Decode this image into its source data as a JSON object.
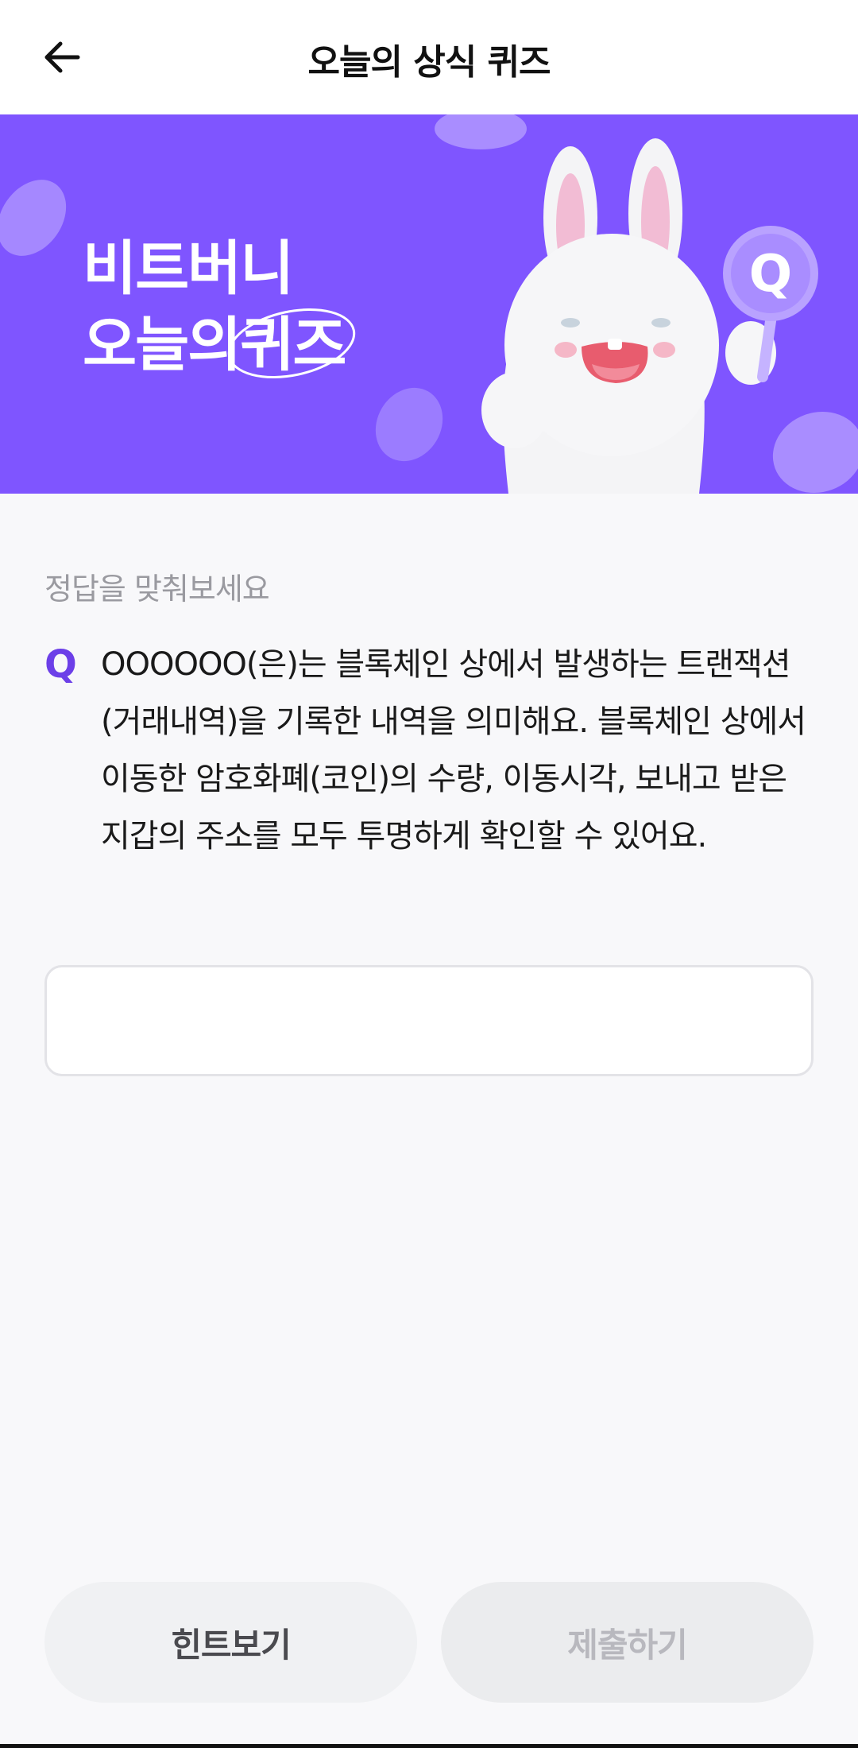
{
  "header": {
    "title": "오늘의 상식 퀴즈"
  },
  "banner": {
    "line1": "비트버니",
    "line2_prefix": "오늘의",
    "line2_highlight": "퀴즈",
    "badge_letter": "Q",
    "bg_color": "#7f55ff"
  },
  "quiz": {
    "prompt": "정답을 맞춰보세요",
    "q_label": "Q",
    "question": "OOOOOO(은)는 블록체인 상에서 발생하는 트랜잭션(거래내역)을 기록한 내역을 의미해요. 블록체인 상에서 이동한 암호화폐(코인)의 수량, 이동시각, 보내고 받은 지갑의 주소를 모두 투명하게 확인할 수 있어요.",
    "answer_value": "",
    "accent_color": "#6c3fe8"
  },
  "buttons": {
    "hint_label": "힌트보기",
    "submit_label": "제출하기"
  }
}
